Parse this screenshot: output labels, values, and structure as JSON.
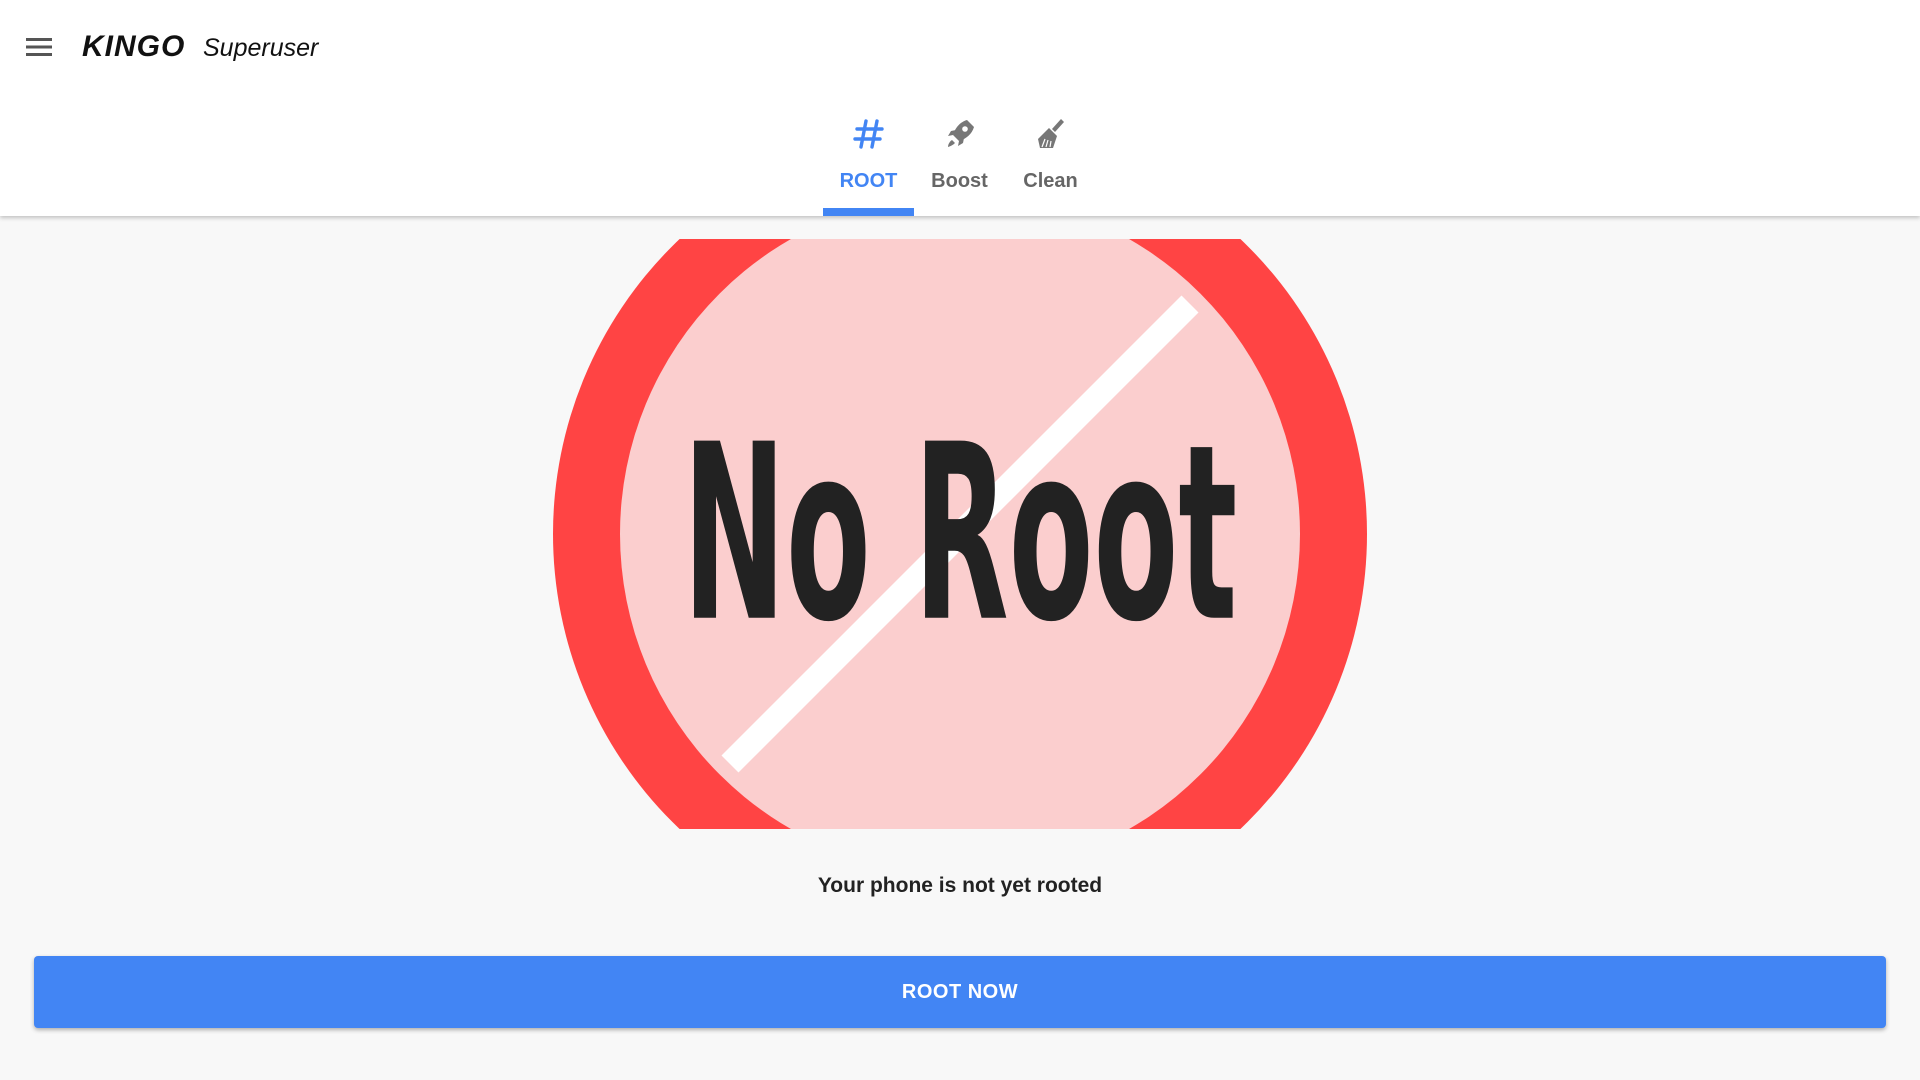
{
  "appbar": {
    "brand": "KINGO",
    "subtitle": "Superuser"
  },
  "tabs": [
    {
      "label": "ROOT",
      "icon": "hash-icon",
      "active": true
    },
    {
      "label": "Boost",
      "icon": "rocket-icon",
      "active": false
    },
    {
      "label": "Clean",
      "icon": "broom-icon",
      "active": false
    }
  ],
  "hero": {
    "text": "No Root"
  },
  "status": {
    "message": "Your phone is not yet rooted"
  },
  "action": {
    "label": "ROOT NOW"
  },
  "colors": {
    "accent": "#4285f4",
    "ring": "#ff4444",
    "disc": "#fbcece",
    "inactive_tab": "#666666"
  }
}
